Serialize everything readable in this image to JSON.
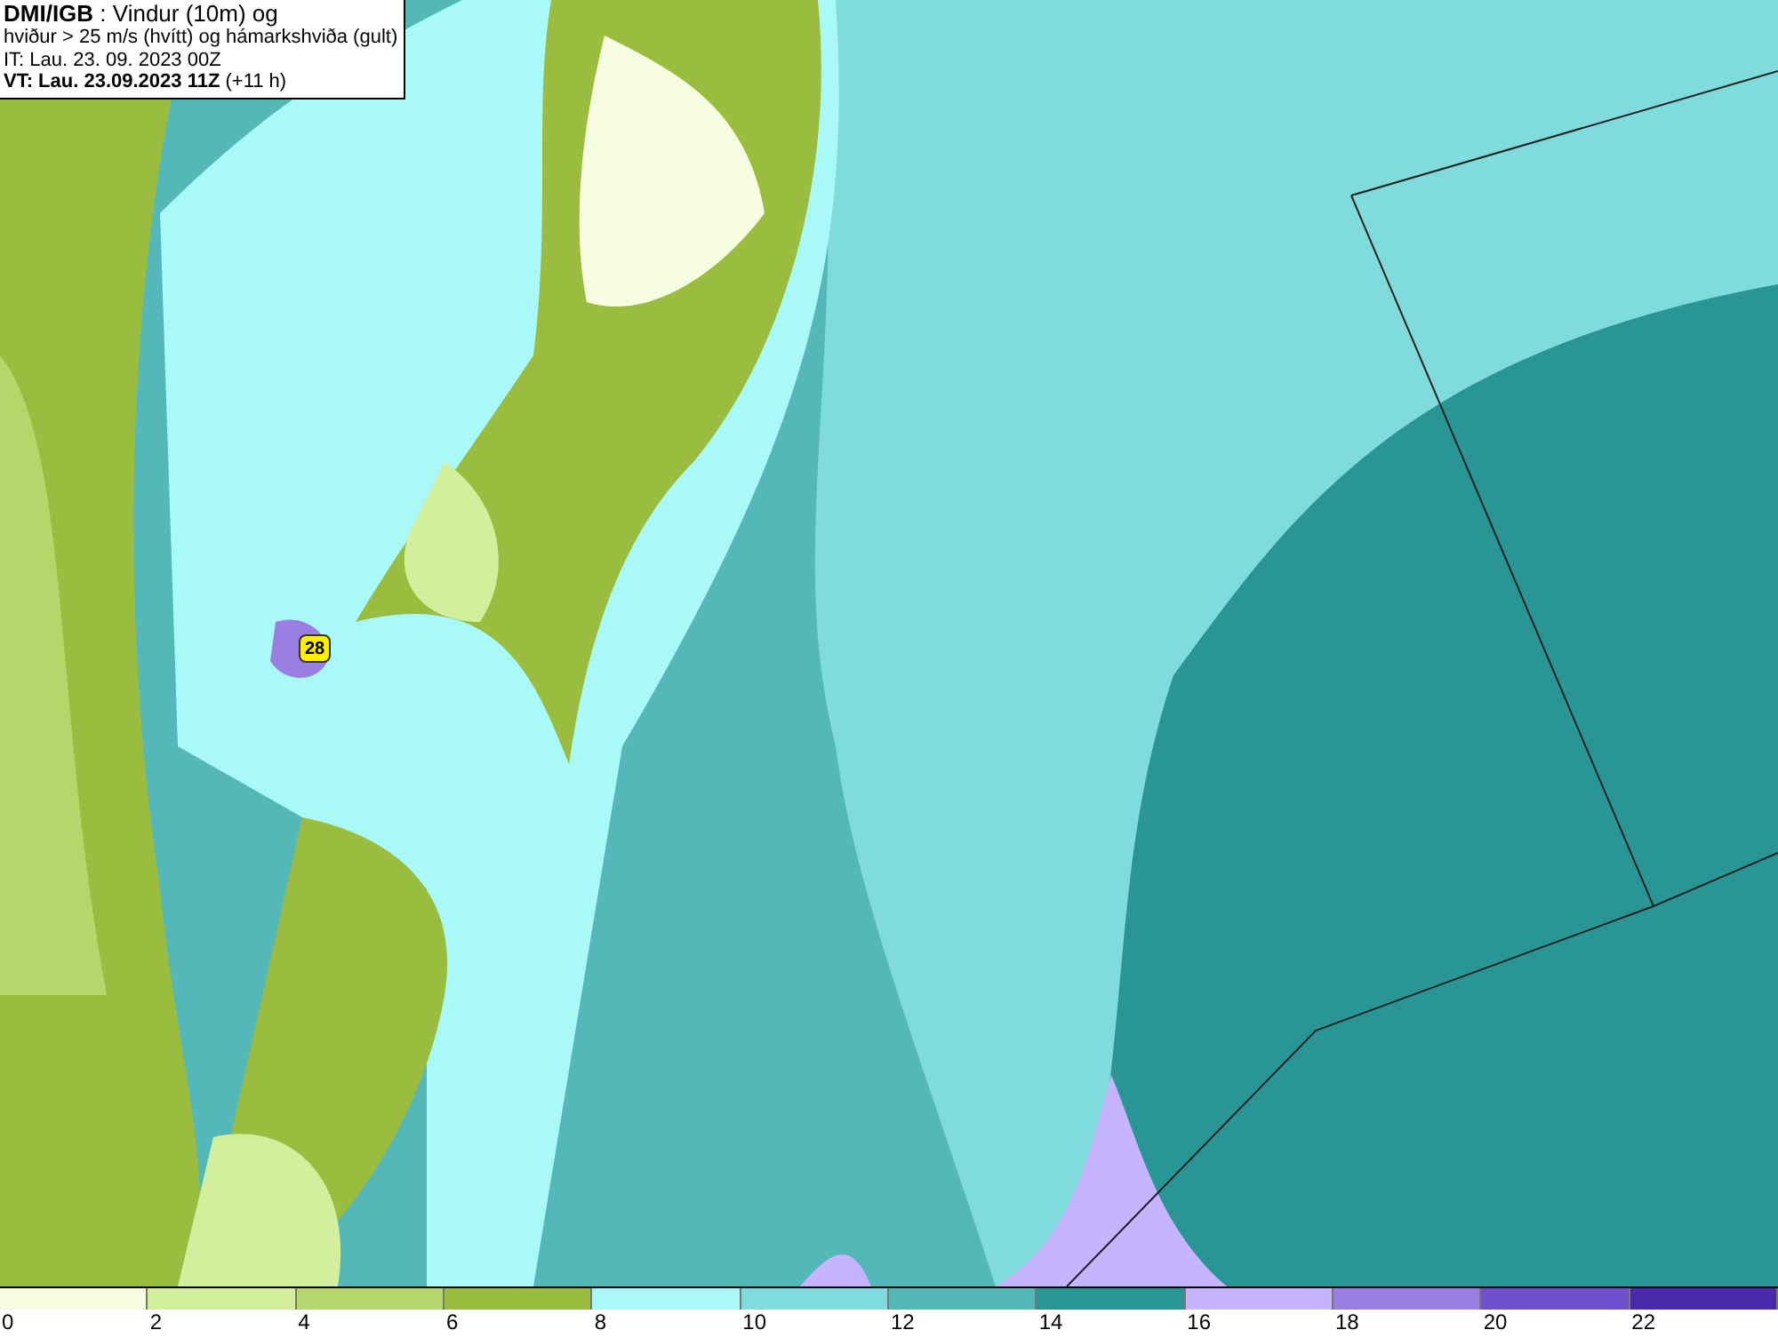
{
  "header": {
    "lines": [
      {
        "text": "**DMI/IGB** : Vindur (10m) og"
      },
      {
        "text": "hviður > 25 m/s (hvítt) og hámarkshviða (gult)"
      },
      {
        "text": "IT: Lau. 23. 09. 2023 00Z"
      },
      {
        "text": "**VT: Lau. 23.09.2023 11Z** (+11 h)"
      }
    ]
  },
  "map": {
    "max_gust": "28"
  },
  "legend": [
    {
      "label": "0",
      "color": "#f7fde0"
    },
    {
      "label": "2",
      "color": "#d3ee9c"
    },
    {
      "label": "4",
      "color": "#b5d66a"
    },
    {
      "label": "6",
      "color": "#9bbd3f"
    },
    {
      "label": "8",
      "color": "#aaf9f9"
    },
    {
      "label": "10",
      "color": "#80dcdc"
    },
    {
      "label": "12",
      "color": "#55b8b8"
    },
    {
      "label": "14",
      "color": "#2a9595"
    },
    {
      "label": "16",
      "color": "#c6b4ff"
    },
    {
      "label": "18",
      "color": "#9b7fe0"
    },
    {
      "label": "20",
      "color": "#7050cc"
    },
    {
      "label": "22",
      "color": "#4a2aaa"
    }
  ]
}
